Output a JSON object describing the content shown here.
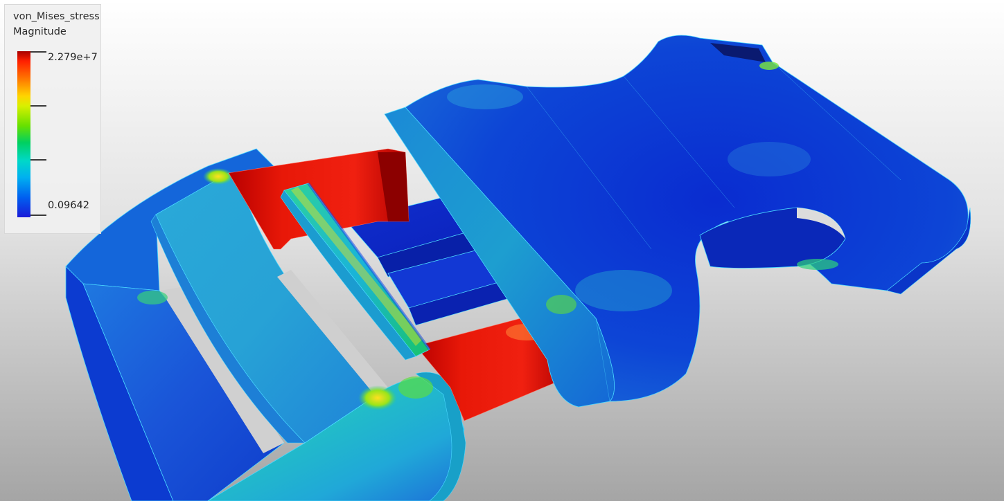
{
  "app": {
    "view": "3D stress result viewport"
  },
  "legend": {
    "title_line1": "von_Mises_stress",
    "title_line2": "Magnitude",
    "max_label": "2.279e+7",
    "min_label": "0.09642",
    "colormap": [
      "#a80000",
      "#ff2000",
      "#ff7a00",
      "#ffd400",
      "#66e000",
      "#00d060",
      "#00d8c8",
      "#00b0f0",
      "#0060f0",
      "#1a1ad8"
    ]
  },
  "scene": {
    "object": "buckle",
    "colors": {
      "body_blue": "#0a3fd8",
      "light_blue": "#2e9ce0",
      "cyan": "#1cc7d8",
      "green": "#2ed27a",
      "yellow": "#e8e21c",
      "red": "#e01808",
      "dark_red": "#9c0000"
    }
  }
}
